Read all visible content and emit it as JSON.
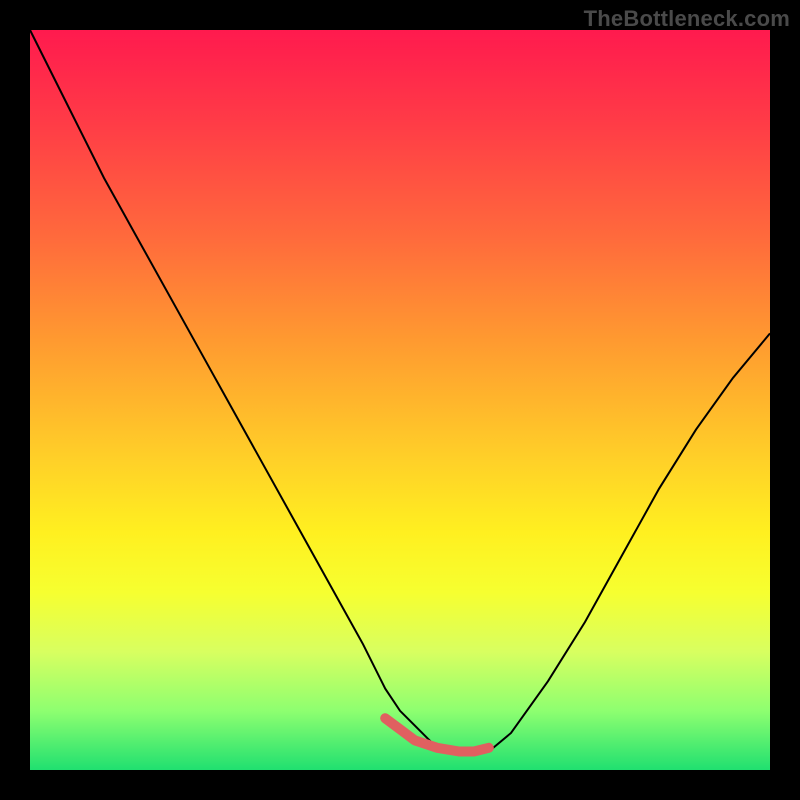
{
  "watermark": {
    "text": "TheBottleneck.com"
  },
  "chart_data": {
    "type": "line",
    "title": "",
    "xlabel": "",
    "ylabel": "",
    "xlim": [
      0,
      100
    ],
    "ylim": [
      0,
      100
    ],
    "grid": false,
    "legend": false,
    "series": [
      {
        "name": "curve",
        "color": "#000000",
        "width": 2,
        "x": [
          0,
          5,
          10,
          15,
          20,
          25,
          30,
          35,
          40,
          45,
          48,
          50,
          52,
          55,
          58,
          60,
          62,
          65,
          70,
          75,
          80,
          85,
          90,
          95,
          100
        ],
        "y": [
          100,
          90,
          80,
          71,
          62,
          53,
          44,
          35,
          26,
          17,
          11,
          8,
          6,
          3,
          2,
          2,
          2.5,
          5,
          12,
          20,
          29,
          38,
          46,
          53,
          59
        ]
      },
      {
        "name": "highlight",
        "color": "#e06060",
        "width": 10,
        "x": [
          48,
          50,
          52,
          55,
          58,
          60,
          62
        ],
        "y": [
          7,
          5.5,
          4,
          3,
          2.5,
          2.5,
          3
        ]
      }
    ]
  }
}
